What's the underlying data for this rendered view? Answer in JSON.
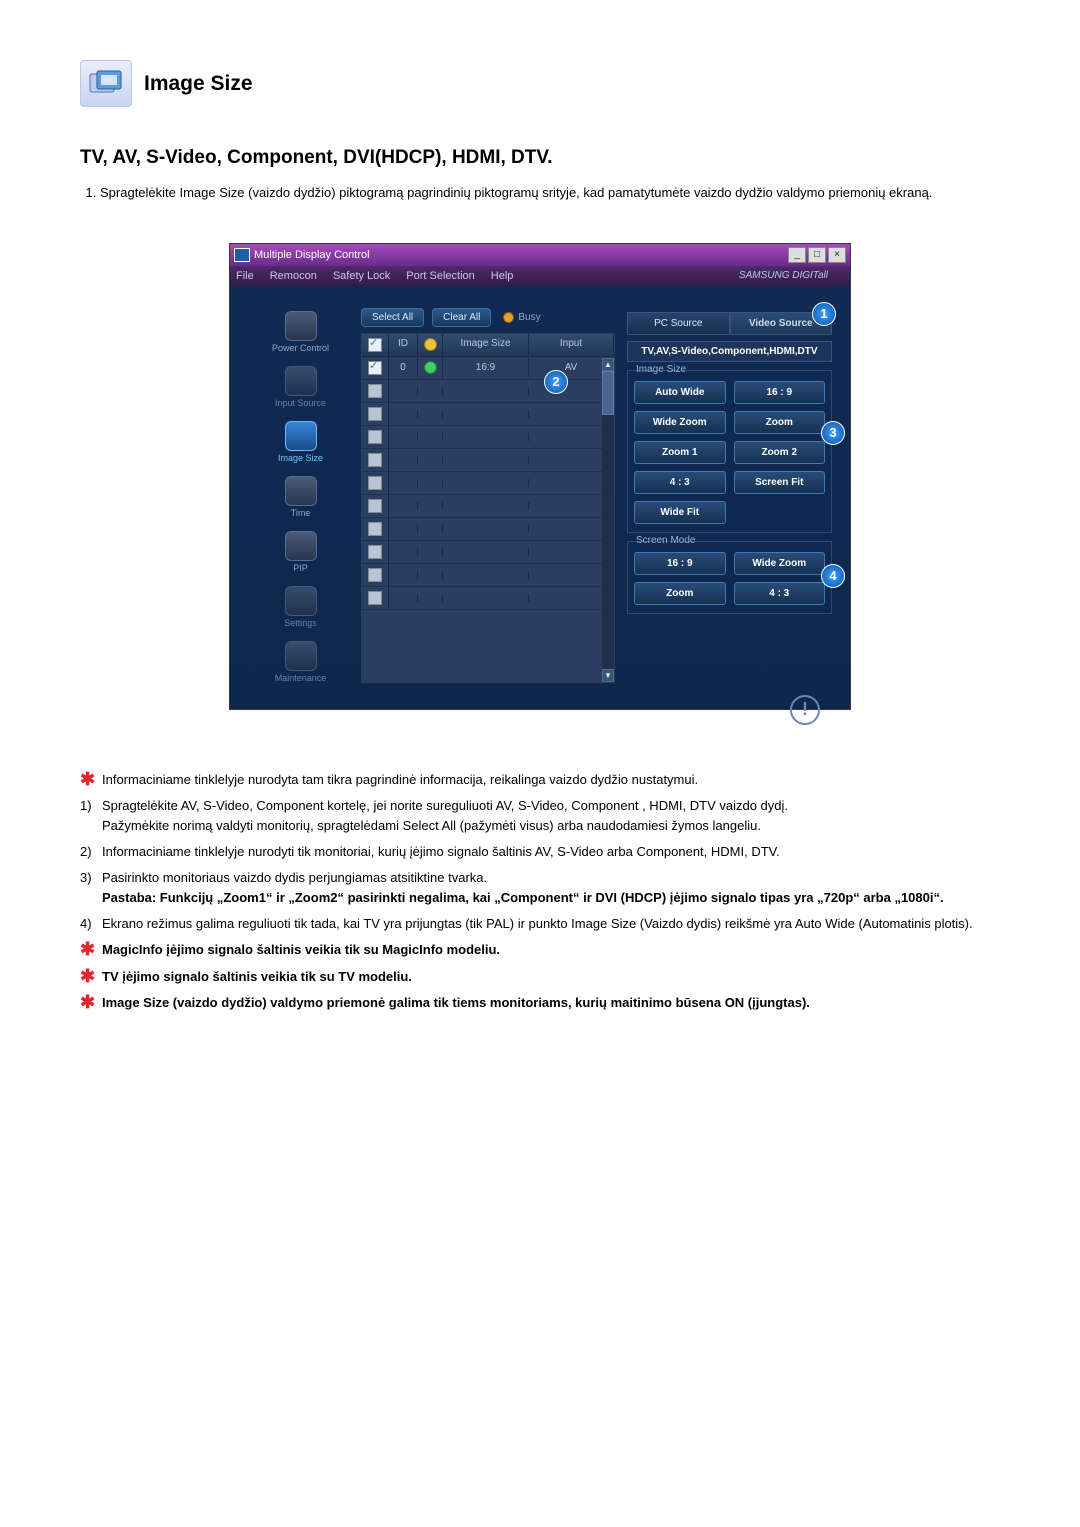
{
  "title": "Image Size",
  "subtitle": "TV, AV, S-Video, Component, DVI(HDCP), HDMI, DTV.",
  "intro": "Spragtelėkite Image Size (vaizdo dydžio) piktogramą pagrindinių piktogramų srityje, kad pamatytumėte vaizdo dydžio valdymo priemonių ekraną.",
  "window": {
    "title": "Multiple Display Control",
    "menus": [
      "File",
      "Remocon",
      "Safety Lock",
      "Port Selection",
      "Help"
    ],
    "brand": "SAMSUNG DIGITall",
    "sidebar": [
      "Power Control",
      "Input Source",
      "Image Size",
      "Time",
      "PIP",
      "Settings",
      "Maintenance"
    ],
    "selectAll": "Select All",
    "clearAll": "Clear All",
    "busy": "Busy",
    "columns": [
      "",
      "ID",
      "",
      "Image Size",
      "Input"
    ],
    "row0": {
      "id": "0",
      "size": "16:9",
      "input": "AV"
    },
    "tabs": {
      "pc": "PC Source",
      "video": "Video Source"
    },
    "sourceLabel": "TV,AV,S-Video,Component,HDMI,DTV",
    "grp1": {
      "legend": "Image Size",
      "btns": [
        "Auto Wide",
        "16 : 9",
        "Wide Zoom",
        "Zoom",
        "Zoom 1",
        "Zoom 2",
        "4 : 3",
        "Screen Fit",
        "Wide Fit"
      ]
    },
    "grp2": {
      "legend": "Screen Mode",
      "btns": [
        "16 : 9",
        "Wide Zoom",
        "Zoom",
        "4 : 3"
      ]
    }
  },
  "info": {
    "starIntro": "Informaciniame tinklelyje nurodyta tam tikra pagrindinė informacija, reikalinga vaizdo dydžio nustatymui.",
    "n1a": "Spragtelėkite AV, S-Video, Component kortelę, jei norite sureguliuoti AV, S-Video, Component , HDMI, DTV vaizdo dydį.",
    "n1b": "Pažymėkite norimą valdyti monitorių, spragtelėdami Select All (pažymėti visus) arba naudodamiesi žymos langeliu.",
    "n2": "Informaciniame tinklelyje nurodyti tik monitoriai, kurių įėjimo signalo šaltinis AV, S-Video arba Component, HDMI, DTV.",
    "n3": "Pasirinkto monitoriaus vaizdo dydis perjungiamas atsitiktine tvarka.",
    "n3b": "Pastaba: Funkcijų „Zoom1“ ir „Zoom2“ pasirinkti negalima, kai „Component“ ir DVI (HDCP) įėjimo signalo tipas yra „720p“ arba „1080i“.",
    "n4": "Ekrano režimus galima reguliuoti tik tada, kai TV yra prijungtas (tik PAL) ir punkto Image Size (Vaizdo dydis) reikšmė yra Auto Wide (Automatinis plotis).",
    "s1": "MagicInfo įėjimo signalo šaltinis veikia tik su MagicInfo modeliu.",
    "s2": "TV įėjimo signalo šaltinis veikia tik su TV modeliu.",
    "s3": "Image Size (vaizdo dydžio) valdymo priemonė galima tik tiems monitoriams, kurių maitinimo būsena ON (įjungtas)."
  }
}
